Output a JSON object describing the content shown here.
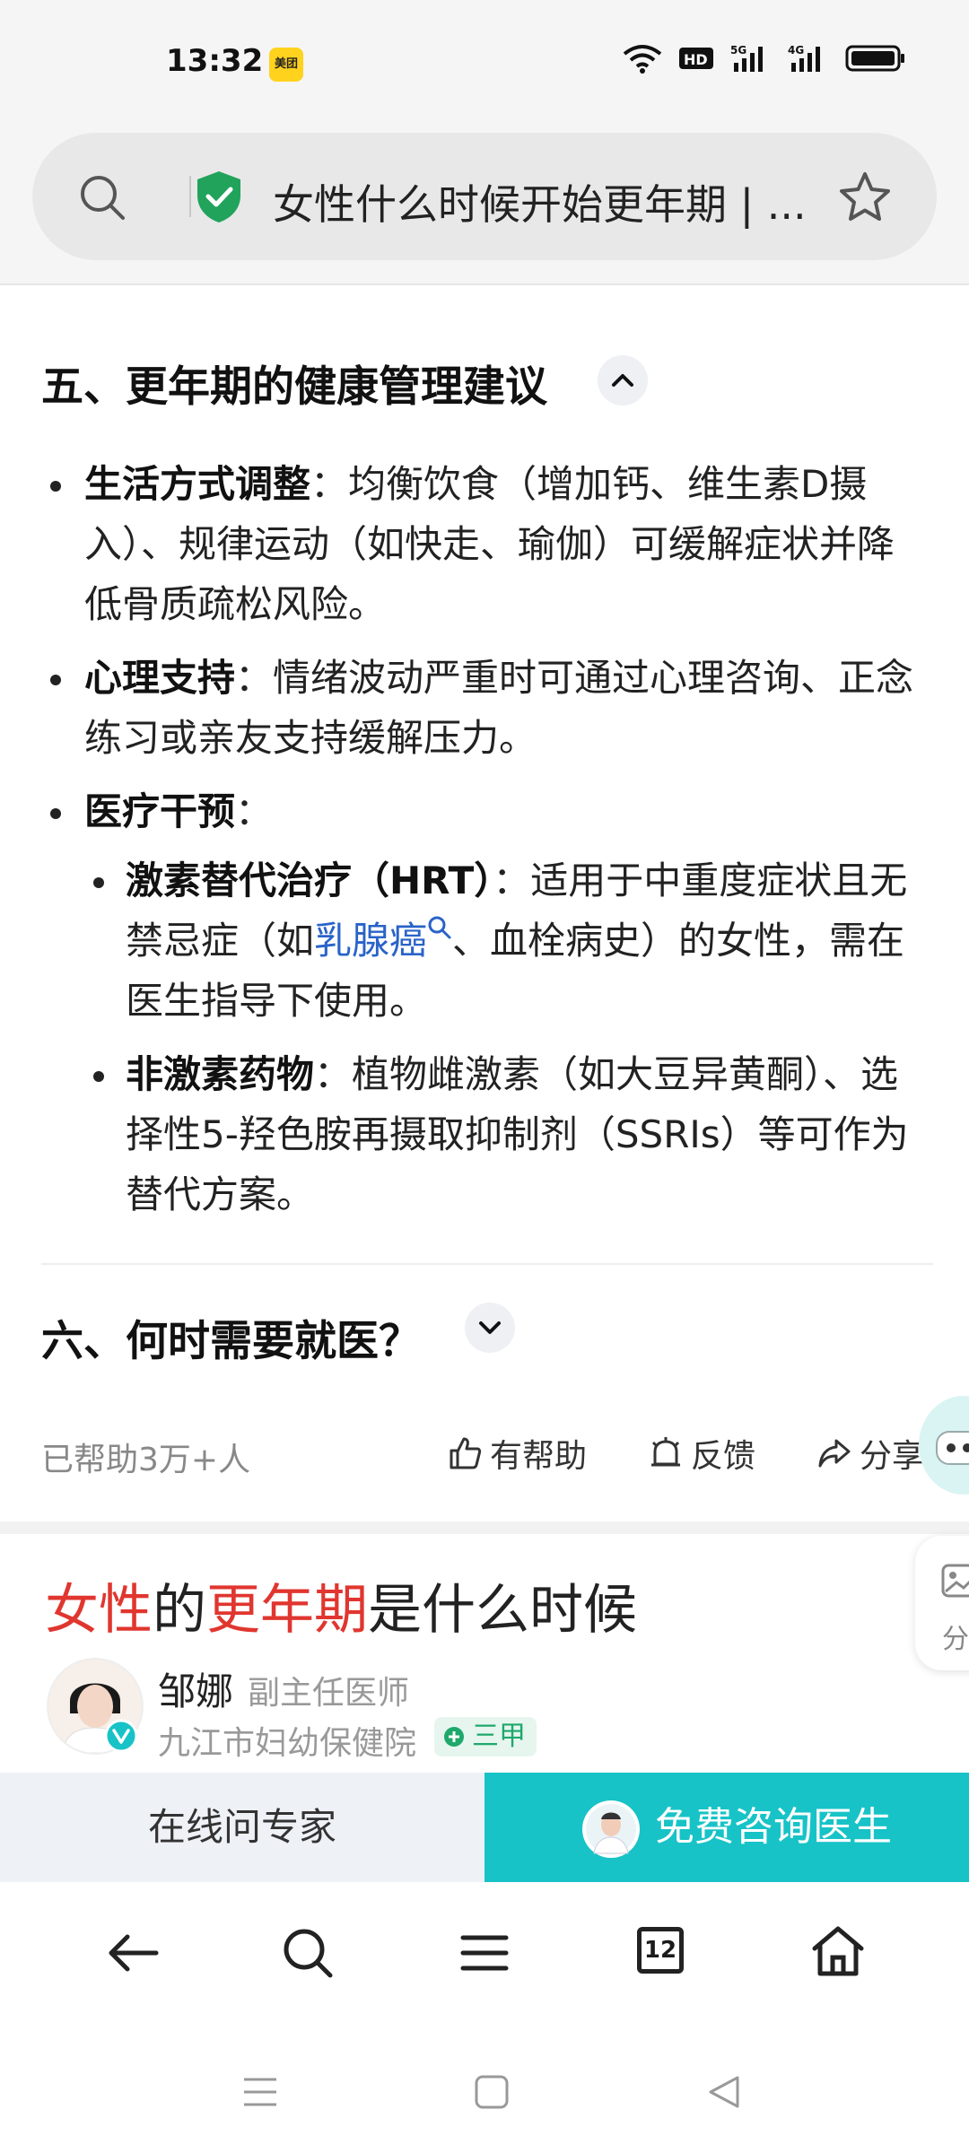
{
  "status_bar": {
    "time": "13:32",
    "app_badge": "美团"
  },
  "address_bar": {
    "title": "女性什么时候开始更年期 | ..."
  },
  "section5": {
    "heading": "五、更年期的健康管理建议",
    "items": [
      {
        "bold": "生活方式调整",
        "text": "：均衡饮食（增加钙、维生素D摄入）、规律运动（如快走、瑜伽）可缓解症状并降低骨质疏松风险。"
      },
      {
        "bold": "心理支持",
        "text": "：情绪波动严重时可通过心理咨询、正念练习或亲友支持缓解压力。"
      },
      {
        "bold": "医疗干预",
        "text": "："
      }
    ],
    "sub_items": [
      {
        "bold": "激素替代治疗（HRT）",
        "pre": "：适用于中重度症状且无禁忌症（如",
        "link": "乳腺癌",
        "post": "、血栓病史）的女性，需在医生指导下使用。"
      },
      {
        "bold": "非激素药物",
        "text": "：植物雌激素（如大豆异黄酮）、选择性5-羟色胺再摄取抑制剂（SSRIs）等可作为替代方案。"
      }
    ]
  },
  "section6": {
    "heading": "六、何时需要就医？"
  },
  "feedback_row": {
    "helped": "已帮助3万+人",
    "helpful": "有帮助",
    "feedback": "反馈",
    "share": "分享"
  },
  "card": {
    "title_parts": [
      "女性",
      "的",
      "更年期",
      "是什么时候"
    ],
    "doctor_name": "邹娜",
    "doctor_title": "副主任医师",
    "hospital": "九江市妇幼保健院",
    "badge": "三甲"
  },
  "side_share_label": "分",
  "cta": {
    "left": "在线问专家",
    "right": "免费咨询医生"
  },
  "bottom_nav": {
    "tabs_count": "12"
  },
  "colors": {
    "accent": "#17c3c7",
    "highlight": "#e0362f",
    "link": "#2a63c8"
  }
}
